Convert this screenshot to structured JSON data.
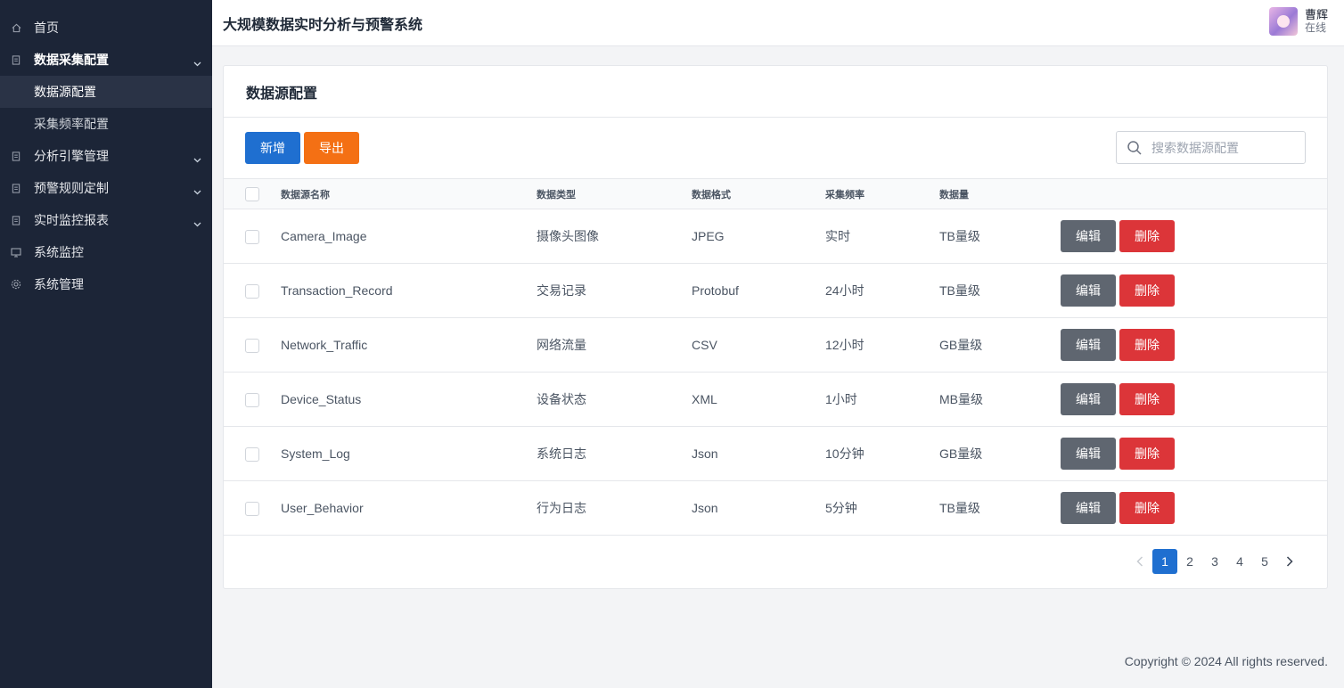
{
  "app": {
    "title": "大规模数据实时分析与预警系统"
  },
  "user": {
    "name": "曹辉",
    "status": "在线"
  },
  "sidebar": {
    "items": [
      {
        "label": "首页",
        "icon": "home-icon"
      },
      {
        "label": "数据采集配置",
        "icon": "doc-icon",
        "expanded": true,
        "children": [
          {
            "label": "数据源配置",
            "active": true
          },
          {
            "label": "采集频率配置"
          }
        ]
      },
      {
        "label": "分析引擎管理",
        "icon": "doc-icon"
      },
      {
        "label": "预警规则定制",
        "icon": "doc-icon"
      },
      {
        "label": "实时监控报表",
        "icon": "doc-icon"
      },
      {
        "label": "系统监控",
        "icon": "monitor-icon"
      },
      {
        "label": "系统管理",
        "icon": "gear-icon"
      }
    ]
  },
  "page": {
    "title": "数据源配置",
    "add_label": "新增",
    "export_label": "导出",
    "search_placeholder": "搜索数据源配置",
    "edit_label": "编辑",
    "delete_label": "删除"
  },
  "table": {
    "columns": [
      "数据源名称",
      "数据类型",
      "数据格式",
      "采集频率",
      "数据量"
    ],
    "rows": [
      [
        "Camera_Image",
        "摄像头图像",
        "JPEG",
        "实时",
        "TB量级"
      ],
      [
        "Transaction_Record",
        "交易记录",
        "Protobuf",
        "24小时",
        "TB量级"
      ],
      [
        "Network_Traffic",
        "网络流量",
        "CSV",
        "12小时",
        "GB量级"
      ],
      [
        "Device_Status",
        "设备状态",
        "XML",
        "1小时",
        "MB量级"
      ],
      [
        "System_Log",
        "系统日志",
        "Json",
        "10分钟",
        "GB量级"
      ],
      [
        "User_Behavior",
        "行为日志",
        "Json",
        "5分钟",
        "TB量级"
      ]
    ]
  },
  "pagination": {
    "pages": [
      "1",
      "2",
      "3",
      "4",
      "5"
    ],
    "current": "1"
  },
  "footer": {
    "copyright": "Copyright © 2024 All rights reserved."
  },
  "colors": {
    "primary": "#1f6fd0",
    "export": "#f47014",
    "danger": "#dc3539",
    "edit": "#5f6670",
    "sidebar": "#1c2537"
  }
}
